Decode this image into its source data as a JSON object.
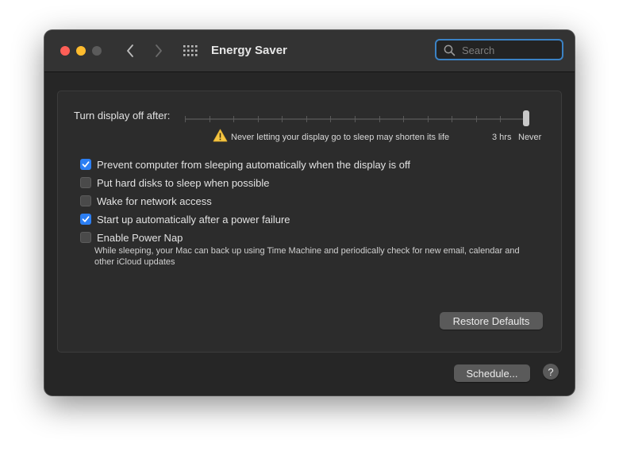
{
  "window": {
    "title": "Energy Saver",
    "search": {
      "placeholder": "Search",
      "value": ""
    }
  },
  "icons": {
    "close": "close-icon",
    "minimize": "minimize-icon",
    "zoom": "zoom-icon",
    "back": "chevron-left-icon",
    "forward": "chevron-right-icon",
    "show_all": "grid-icon",
    "search": "search-icon",
    "warning": "warning-icon",
    "checkmark": "checkmark-icon"
  },
  "display_sleep": {
    "label": "Turn display off after:",
    "warning": "Never letting your display go to sleep may shorten its life",
    "tick_3hrs": "3 hrs",
    "tick_never": "Never",
    "selected_value": "Never"
  },
  "options": [
    {
      "label": "Prevent computer from sleeping automatically when the display is off",
      "checked": true
    },
    {
      "label": "Put hard disks to sleep when possible",
      "checked": false
    },
    {
      "label": "Wake for network access",
      "checked": false
    },
    {
      "label": "Start up automatically after a power failure",
      "checked": true
    },
    {
      "label": "Enable Power Nap",
      "checked": false
    }
  ],
  "power_nap_description": "While sleeping, your Mac can back up using Time Machine and periodically check for new email, calendar and other iCloud updates",
  "buttons": {
    "restore_defaults": "Restore Defaults",
    "schedule": "Schedule...",
    "help": "?"
  },
  "colors": {
    "accent": "#2c7ff3",
    "close": "#fe5f57",
    "minimize": "#febc2e",
    "zoom_disabled": "#5b5b5b",
    "warning": "#f5c542"
  }
}
